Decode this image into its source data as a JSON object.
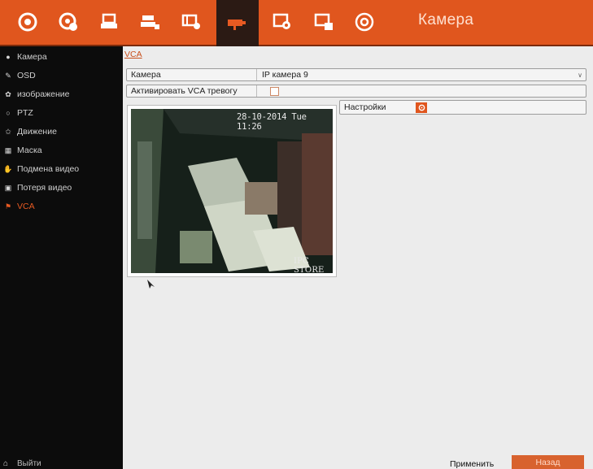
{
  "header": {
    "title": "Камера",
    "toolbar_icons": [
      "live-view-icon",
      "playback-icon",
      "record-icon",
      "network-icon",
      "device-icon",
      "camera-icon",
      "config-icon",
      "display-icon",
      "power-icon"
    ],
    "active_index": 5,
    "accent_color": "#e0561e"
  },
  "sidebar": {
    "items": [
      {
        "label": "Камера",
        "icon": "camera-icon"
      },
      {
        "label": "OSD",
        "icon": "osd-icon"
      },
      {
        "label": "изображение",
        "icon": "image-icon"
      },
      {
        "label": "PTZ",
        "icon": "ptz-icon"
      },
      {
        "label": "Движение",
        "icon": "motion-icon"
      },
      {
        "label": "Маска",
        "icon": "mask-icon"
      },
      {
        "label": "Подмена видео",
        "icon": "tamper-icon"
      },
      {
        "label": "Потеря видео",
        "icon": "video-loss-icon"
      },
      {
        "label": "VCA",
        "icon": "vca-icon"
      }
    ],
    "active": "VCA",
    "exit_label": "Выйти"
  },
  "main": {
    "breadcrumb": "VCA",
    "camera": {
      "label": "Камера",
      "value": "IP камера 9"
    },
    "alarm": {
      "label": "Активировать VCA тревогу",
      "checked": false
    },
    "settings": {
      "label": "Настройки"
    },
    "preview": {
      "timestamp": "28-10-2014 Tue 11:26",
      "camera_name": "IPC STORE"
    },
    "apply_label": "Применить",
    "back_label": "Назад"
  }
}
